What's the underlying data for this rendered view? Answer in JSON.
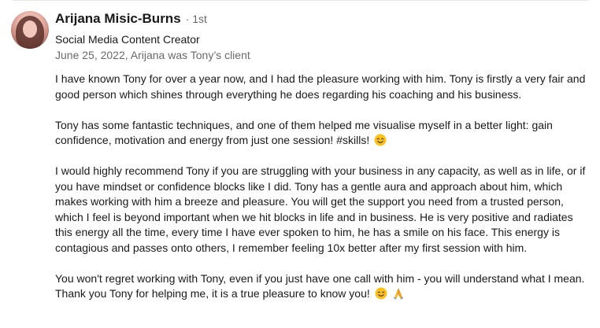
{
  "recommender": {
    "name": "Arijana Misic-Burns",
    "degree": "· 1st",
    "headline": "Social Media Content Creator",
    "meta": "June 25, 2022, Arijana was Tony’s client"
  },
  "recommendation": {
    "p1": "I have known Tony for over a year now, and I had the pleasure working with him. Tony is firstly a very fair and good person which shines through everything he does regarding his coaching and his business.",
    "p2": "Tony has some fantastic techniques, and one of them helped me visualise myself in a better light: gain confidence, motivation and energy from just one session! #skills!",
    "p3": "I would highly recommend Tony if you are struggling with your business in any capacity, as well as in life, or if you have mindset or confidence blocks like I did. Tony has a gentle aura and approach about him, which makes working with him a breeze and pleasure. You will get the support you need from a trusted person, which I feel is beyond important when we hit blocks in life and in business. He is very positive and radiates this energy all the time, every time I have ever spoken to him, he has a smile on his face. This energy is contagious and passes onto others, I remember feeling 10x better after my first session with him.",
    "p4": "You won't regret working with Tony, even if you just have one call with him - you will understand what I mean. Thank you Tony for helping me, it is a true pleasure to know you!"
  },
  "icons": {
    "smile": "smiling-face-emoji",
    "pray": "folded-hands-emoji"
  }
}
